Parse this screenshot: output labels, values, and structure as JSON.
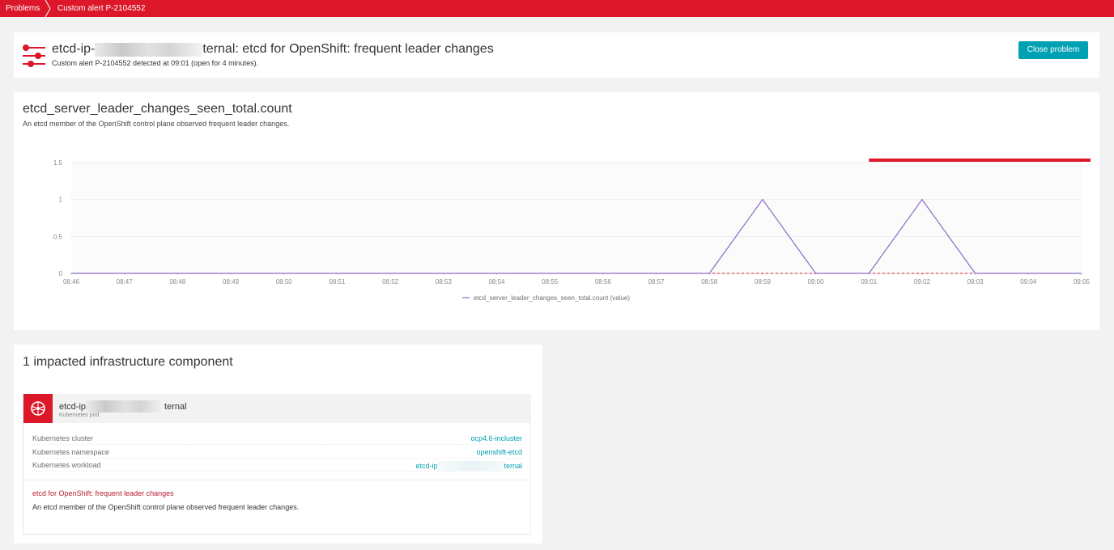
{
  "breadcrumb": {
    "items": [
      "Problems",
      "Custom alert P-2104552"
    ]
  },
  "problem": {
    "title_prefix": "etcd-ip-",
    "title_suffix": "ternal: etcd for OpenShift: frequent leader changes",
    "subtitle": "Custom alert P-2104552 detected at 09:01 (open for 4 minutes).",
    "close_button": "Close problem"
  },
  "metric": {
    "name": "etcd_server_leader_changes_seen_total.count",
    "description": "An etcd member of the OpenShift control plane observed frequent leader changes."
  },
  "chart_data": {
    "type": "line",
    "x": [
      "08:46",
      "08:47",
      "08:48",
      "08:49",
      "08:50",
      "08:51",
      "08:52",
      "08:53",
      "08:54",
      "08:55",
      "08:56",
      "08:57",
      "08:58",
      "08:59",
      "09:00",
      "09:01",
      "09:02",
      "09:03",
      "09:04",
      "09:05"
    ],
    "series": [
      {
        "name": "etcd_server_leader_changes_seen_total.count (value)",
        "color": "#8e6bc4",
        "points": [
          {
            "x": "08:46",
            "y": 0
          },
          {
            "x": "08:58",
            "y": 0
          },
          {
            "x": "08:59",
            "y": 1
          },
          {
            "x": "09:00",
            "y": 0
          },
          {
            "x": "09:01",
            "y": 0
          },
          {
            "x": "09:02",
            "y": 1
          },
          {
            "x": "09:03",
            "y": 0
          },
          {
            "x": "09:05",
            "y": 0
          }
        ]
      }
    ],
    "threshold": {
      "value": 0,
      "color": "#dc172a",
      "style": "dashed"
    },
    "problem_interval": {
      "start": "09:01",
      "end": "09:05",
      "color": "#dc172a"
    },
    "yticks": [
      "0",
      "0.5",
      "1",
      "1.5"
    ],
    "ylim": [
      0,
      1.5
    ],
    "title": "",
    "xlabel": "",
    "ylabel": "",
    "grid": true,
    "legend_position": "bottom"
  },
  "impacted": {
    "title": "1 impacted infrastructure component",
    "entity_prefix": "etcd-ip",
    "entity_suffix": "ternal",
    "entity_type": "Kubernetes pod",
    "pod_icon": "kubernetes-icon",
    "properties": [
      {
        "key": "Kubernetes cluster",
        "value": "ocp4.6-incluster"
      },
      {
        "key": "Kubernetes namespace",
        "value": "openshift-etcd"
      },
      {
        "key": "Kubernetes workload",
        "value_prefix": "etcd-ip",
        "value_suffix": "ternal"
      }
    ],
    "event_title": "etcd for OpenShift: frequent leader changes",
    "event_description": "An etcd member of the OpenShift control plane observed frequent leader changes."
  },
  "colors": {
    "brand_red": "#dc172a",
    "accent_teal": "#00a1b2",
    "series_purple": "#8e6bc4"
  }
}
